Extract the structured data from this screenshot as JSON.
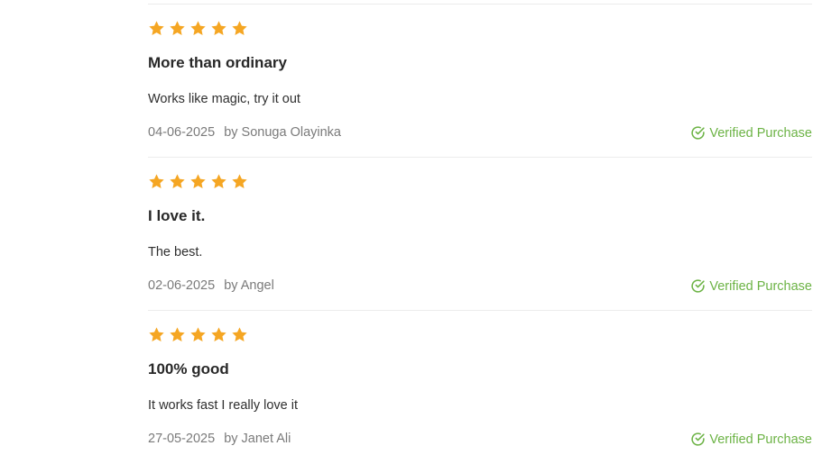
{
  "reviews": [
    {
      "rating": 5,
      "title": "More than ordinary",
      "body": "Works like magic, try it out",
      "date": "04-06-2025",
      "author": "by Sonuga Olayinka",
      "verified_label": "Verified Purchase"
    },
    {
      "rating": 5,
      "title": "I love it.",
      "body": "The best.",
      "date": "02-06-2025",
      "author": "by Angel",
      "verified_label": "Verified Purchase"
    },
    {
      "rating": 5,
      "title": "100% good",
      "body": "It works fast I really love it",
      "date": "27-05-2025",
      "author": "by Janet Ali",
      "verified_label": "Verified Purchase"
    }
  ],
  "colors": {
    "star": "#f5a623",
    "verified": "#6cb345",
    "divider": "#ececec"
  },
  "icons": {
    "star": "star-icon",
    "verified": "check-circle-icon"
  }
}
